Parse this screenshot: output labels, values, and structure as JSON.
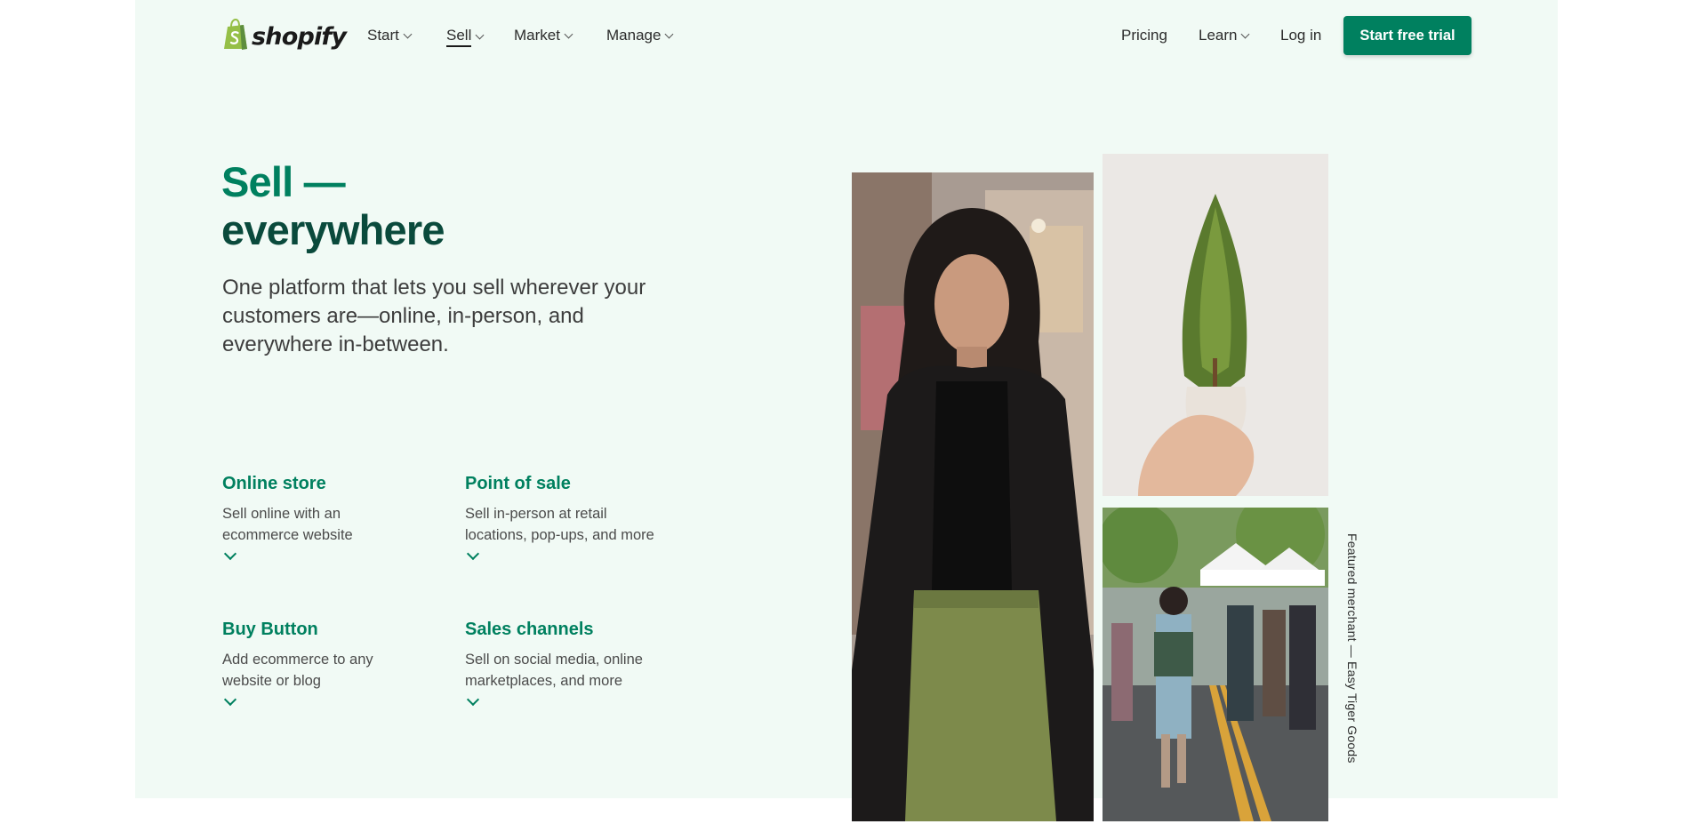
{
  "brand": {
    "name": "shopify",
    "icon": "shopping-bag-icon",
    "color": "#95bf47"
  },
  "nav": {
    "left": [
      {
        "label": "Start",
        "dropdown": true
      },
      {
        "label": "Sell",
        "dropdown": true,
        "active": true
      },
      {
        "label": "Market",
        "dropdown": true
      },
      {
        "label": "Manage",
        "dropdown": true
      }
    ],
    "right": [
      {
        "label": "Pricing",
        "dropdown": false
      },
      {
        "label": "Learn",
        "dropdown": true
      },
      {
        "label": "Log in",
        "dropdown": false
      }
    ],
    "cta": "Start free trial"
  },
  "hero": {
    "title_line1": "Sell —",
    "title_line2": "everywhere",
    "subtitle": "One platform that lets you sell wherever your customers are—online, in-person, and everywhere in-between."
  },
  "features": [
    {
      "title": "Online store",
      "description": "Sell online with an ecommerce website"
    },
    {
      "title": "Point of sale",
      "description": "Sell in-person at retail locations, pop-ups, and more"
    },
    {
      "title": "Buy Button",
      "description": "Add ecommerce to any website or blog"
    },
    {
      "title": "Sales channels",
      "description": "Sell on social media, online marketplaces, and more"
    }
  ],
  "caption": "Featured merchant — Easy Tiger Goods",
  "colors": {
    "accent": "#00805f",
    "dark_green": "#0a4a3c",
    "hero_bg": "#f1faf5"
  }
}
